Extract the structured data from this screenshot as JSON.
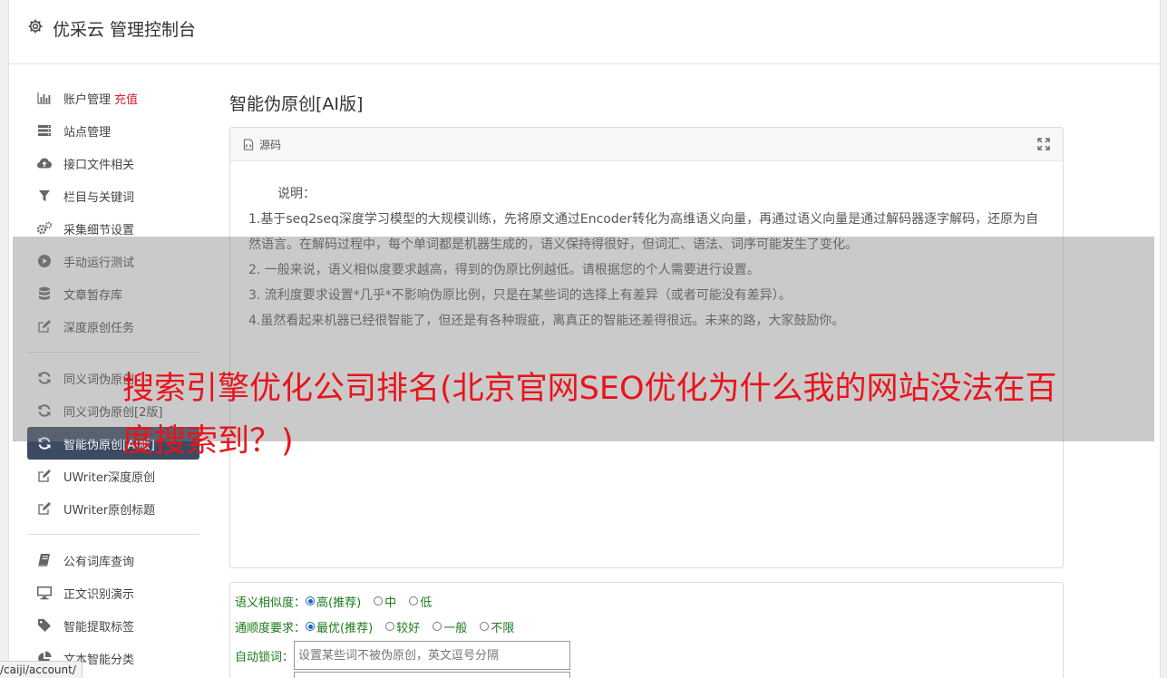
{
  "header": {
    "title": "优采云 管理控制台"
  },
  "sidebar": {
    "groups": [
      [
        {
          "label": "账户管理",
          "badge": "充值",
          "icon": "bar-chart-icon"
        },
        {
          "label": "站点管理",
          "icon": "server-icon"
        },
        {
          "label": "接口文件相关",
          "icon": "cloud-upload-icon"
        },
        {
          "label": "栏目与关键词",
          "icon": "filter-icon"
        },
        {
          "label": "采集细节设置",
          "icon": "gears-icon"
        },
        {
          "label": "手动运行测试",
          "icon": "play-circle-icon"
        },
        {
          "label": "文章暂存库",
          "icon": "database-icon"
        },
        {
          "label": "深度原创任务",
          "icon": "edit-icon"
        }
      ],
      [
        {
          "label": "同义词伪原创",
          "icon": "refresh-icon"
        },
        {
          "label": "同义词伪原创[2版]",
          "icon": "refresh-icon"
        },
        {
          "label": "智能伪原创[AI版]",
          "icon": "refresh-icon",
          "active": true
        },
        {
          "label": "UWriter深度原创",
          "icon": "edit-icon"
        },
        {
          "label": "UWriter原创标题",
          "icon": "edit-icon"
        }
      ],
      [
        {
          "label": "公有词库查询",
          "icon": "book-icon"
        },
        {
          "label": "正文识别演示",
          "icon": "monitor-icon"
        },
        {
          "label": "智能提取标签",
          "icon": "tag-icon"
        },
        {
          "label": "文本智能分类",
          "icon": "pie-chart-icon"
        }
      ]
    ]
  },
  "main": {
    "title": "智能伪原创[AI版]",
    "panel": {
      "tab_label": "源码",
      "intro": "说明：",
      "lines": [
        "1.基于seq2seq深度学习模型的大规模训练，先将原文通过Encoder转化为高维语义向量，再通过语义向量是通过解码器逐字解码，还原为自然语言。在解码过程中，每个单词都是机器生成的，语义保持得很好，但词汇、语法、词序可能发生了变化。",
        "2. 一般来说，语义相似度要求越高，得到的伪原比例越低。请根据您的个人需要进行设置。",
        "3. 流利度要求设置*几乎*不影响伪原比例，只是在某些词的选择上有差异（或者可能没有差异）。",
        "4.虽然看起来机器已经很智能了，但还是有各种瑕疵，离真正的智能还差得很远。未来的路，大家鼓励你。"
      ]
    },
    "form": {
      "similarity": {
        "label": "语义相似度：",
        "options": [
          "高(推荐)",
          "中",
          "低"
        ],
        "selected": 0
      },
      "fluency": {
        "label": "通顺度要求：",
        "options": [
          "最优(推荐)",
          "较好",
          "一般",
          "不限"
        ],
        "selected": 0
      },
      "lock_words": {
        "label": "自动锁词：",
        "placeholder": "设置某些词不被伪原创，英文逗号分隔"
      }
    }
  },
  "overlay": {
    "text": "搜索引擎优化公司排名(北京官网SEO优化为什么我的网站没法在百度搜索到？)"
  },
  "status_bar": {
    "url": "/caiji/account/"
  }
}
